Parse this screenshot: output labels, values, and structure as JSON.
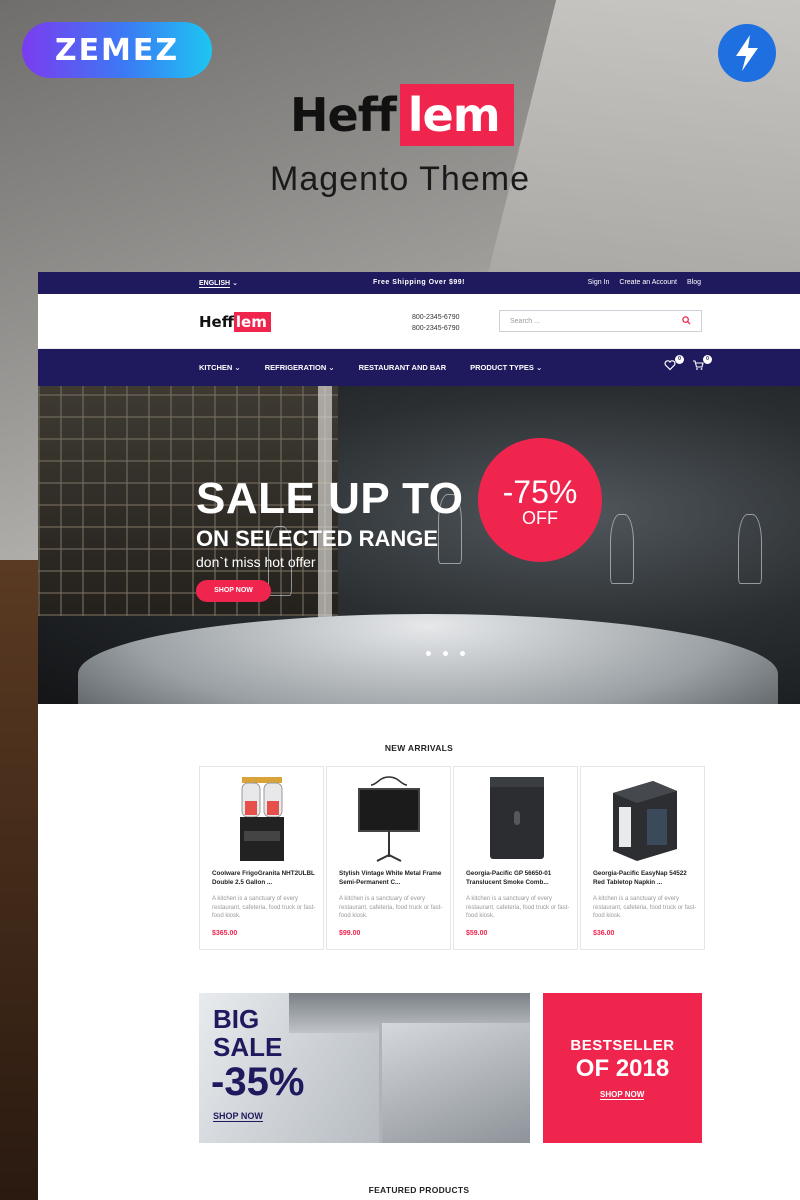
{
  "promo": {
    "badge_text": "ZEMEZ",
    "brand_part1": "Heff",
    "brand_part2": "lem",
    "subtitle": "Magento Theme"
  },
  "topbar": {
    "language": "ENGLISH",
    "shipping_note": "Free Shipping Over $99!",
    "links": [
      "Sign In",
      "Create an Account",
      "Blog"
    ]
  },
  "header": {
    "logo_part1": "Heff",
    "logo_part2": "lem",
    "phones": [
      "800-2345-6790",
      "800-2345-6790"
    ],
    "search_placeholder": "Search ..."
  },
  "nav": {
    "items": [
      {
        "label": "KITCHEN",
        "has_dropdown": true
      },
      {
        "label": "REFRIGERATION",
        "has_dropdown": true
      },
      {
        "label": "RESTAURANT AND BAR",
        "has_dropdown": false
      },
      {
        "label": "PRODUCT TYPES",
        "has_dropdown": true
      }
    ],
    "wishlist_count": "0",
    "cart_count": "0"
  },
  "hero": {
    "line1": "SALE UP TO",
    "line2": "ON SELECTED RANGE",
    "line3": "don`t miss hot offer",
    "cta": "SHOP NOW",
    "discount": "-75%",
    "discount_suffix": "OFF",
    "slides_count": 3
  },
  "new_arrivals": {
    "title": "NEW ARRIVALS",
    "products": [
      {
        "name": "Coolware FrigoGranita NHT2ULBL Double 2.5 Gallon ...",
        "desc": "A kitchen is a sanctuary of every restaurant, cafeteria, food truck or fast-food kiosk.",
        "price": "$365.00",
        "icon": "slush-machine-icon"
      },
      {
        "name": "Stylish Vintage White Metal Frame Semi-Permanent C...",
        "desc": "A kitchen is a sanctuary of every restaurant, cafeteria, food truck or fast-food kiosk.",
        "price": "$99.00",
        "icon": "chalkboard-easel-icon"
      },
      {
        "name": "Georgia-Pacific GP 56650-01 Translucent Smoke Comb...",
        "desc": "A kitchen is a sanctuary of every restaurant, cafeteria, food truck or fast-food kiosk.",
        "price": "$59.00",
        "icon": "towel-dispenser-icon"
      },
      {
        "name": "Georgia-Pacific EasyNap 54522 Red Tabletop Napkin ...",
        "desc": "A kitchen is a sanctuary of every restaurant, cafeteria, food truck or fast-food kiosk.",
        "price": "$36.00",
        "icon": "napkin-dispenser-icon"
      }
    ]
  },
  "banner_sale": {
    "line1": "BIG",
    "line2": "SALE",
    "discount": "-35%",
    "cta": "SHOP NOW"
  },
  "banner_bestseller": {
    "line1": "BESTSELLER",
    "line2": "OF 2018",
    "cta": "SHOP NOW"
  },
  "featured": {
    "title": "FEATURED PRODUCTS"
  },
  "colors": {
    "navy": "#1f1a5e",
    "accent": "#f0254e"
  }
}
